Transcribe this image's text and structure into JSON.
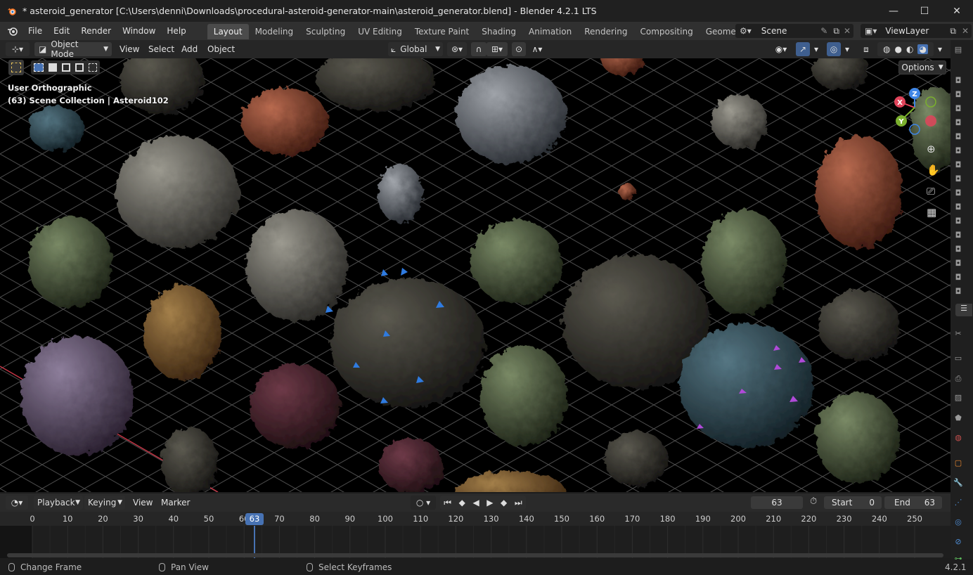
{
  "window": {
    "title": "* asteroid_generator [C:\\Users\\denni\\Downloads\\procedural-asteroid-generator-main\\asteroid_generator.blend] - Blender 4.2.1 LTS",
    "minimize": "—",
    "maximize": "☐",
    "close": "✕"
  },
  "menu": {
    "items": [
      "File",
      "Edit",
      "Render",
      "Window",
      "Help"
    ]
  },
  "workspaces": {
    "tabs": [
      "Layout",
      "Modeling",
      "Sculpting",
      "UV Editing",
      "Texture Paint",
      "Shading",
      "Animation",
      "Rendering",
      "Compositing",
      "Geometry Nodes"
    ],
    "active": "Layout"
  },
  "scene": {
    "name": "Scene",
    "view_layer": "ViewLayer"
  },
  "viewport_header": {
    "mode": "Object Mode",
    "menus": [
      "View",
      "Select",
      "Add",
      "Object"
    ],
    "orientation": "Global",
    "options": "Options"
  },
  "viewport": {
    "view_name": "User Orthographic",
    "collection_info": "(63) Scene Collection | Asteroid102",
    "gizmo": {
      "x": "X",
      "y": "Y",
      "z": "Z"
    },
    "colors": {
      "axis_x": "#e0445b",
      "axis_y": "#7bb02e",
      "axis_z": "#3f86e6",
      "grid": "#4a4a4a"
    }
  },
  "timeline": {
    "menus": [
      "Playback",
      "Keying",
      "View",
      "Marker"
    ],
    "current_frame": "63",
    "start_label": "Start",
    "start": "0",
    "end_label": "End",
    "end": "63",
    "ticks": [
      "0",
      "10",
      "20",
      "30",
      "40",
      "50",
      "60",
      "70",
      "80",
      "90",
      "100",
      "110",
      "120",
      "130",
      "140",
      "150",
      "160",
      "170",
      "180",
      "190",
      "200",
      "210",
      "220",
      "230",
      "240",
      "250"
    ],
    "playhead_label": "63",
    "accent": "#4772b3"
  },
  "status": {
    "change_frame": "Change Frame",
    "pan_view": "Pan View",
    "select_keyframes": "Select Keyframes",
    "version": "4.2.1"
  }
}
